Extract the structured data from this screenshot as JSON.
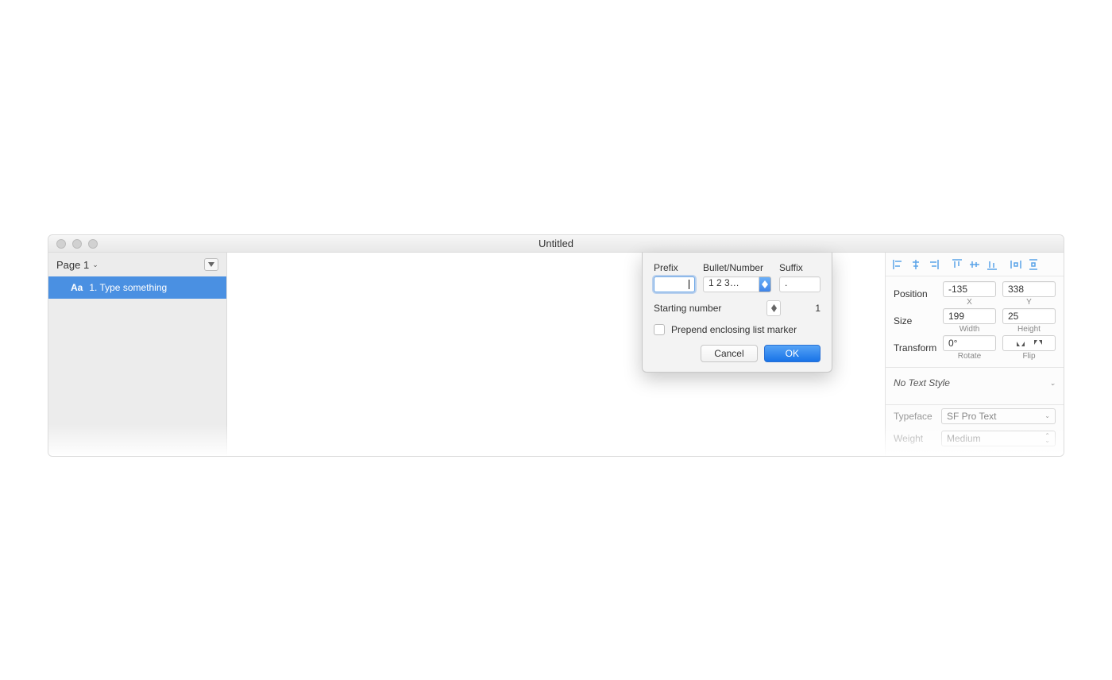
{
  "window": {
    "title": "Untitled"
  },
  "sidebar": {
    "page_label": "Page 1",
    "layer": {
      "icon_text": "Aa",
      "name": "1. Type something"
    }
  },
  "dialog": {
    "prefix_label": "Prefix",
    "prefix_value": "",
    "bullet_label": "Bullet/Number",
    "bullet_value": "1 2 3…",
    "suffix_label": "Suffix",
    "suffix_value": ".",
    "starting_number_label": "Starting number",
    "starting_number_value": "1",
    "prepend_label": "Prepend enclosing list marker",
    "prepend_checked": false,
    "cancel": "Cancel",
    "ok": "OK"
  },
  "inspector": {
    "position_label": "Position",
    "x_value": "-135",
    "x_sub": "X",
    "y_value": "338",
    "y_sub": "Y",
    "size_label": "Size",
    "width_value": "199",
    "width_sub": "Width",
    "height_value": "25",
    "height_sub": "Height",
    "transform_label": "Transform",
    "rotate_value": "0°",
    "rotate_sub": "Rotate",
    "flip_sub": "Flip",
    "text_style": "No Text Style",
    "typeface_label": "Typeface",
    "typeface_value": "SF Pro Text",
    "weight_label": "Weight",
    "weight_value": "Medium"
  }
}
